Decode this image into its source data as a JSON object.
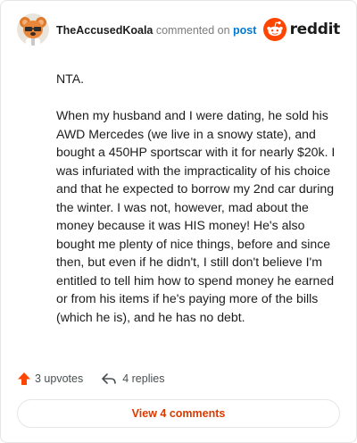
{
  "header": {
    "username": "TheAccusedKoala",
    "action_text": "commented on",
    "post_label": "post",
    "brand_name": "reddit"
  },
  "comment": {
    "paragraphs": [
      "NTA.",
      "When my husband and I were dating, he sold his AWD Mercedes (we live in a snowy state), and bought a 450HP sportscar with it for nearly $20k. I was infuriated with the impracticality of his choice and that he expected to borrow my 2nd car during the winter. I was not, however, mad about the money because it was HIS money! He's also bought me plenty of nice things, before and since then, but even if he didn't, I still don't believe I'm entitled to tell him how to spend money he earned or from his items if he's paying more of the bills (which he is), and he has no debt."
    ]
  },
  "actions": {
    "upvotes_label": "3 upvotes",
    "replies_label": "4 replies"
  },
  "view_button": {
    "label": "View 4 comments"
  },
  "colors": {
    "brand_orange": "#ff4500",
    "link_blue": "#0079d3",
    "button_text": "#d93a00"
  }
}
